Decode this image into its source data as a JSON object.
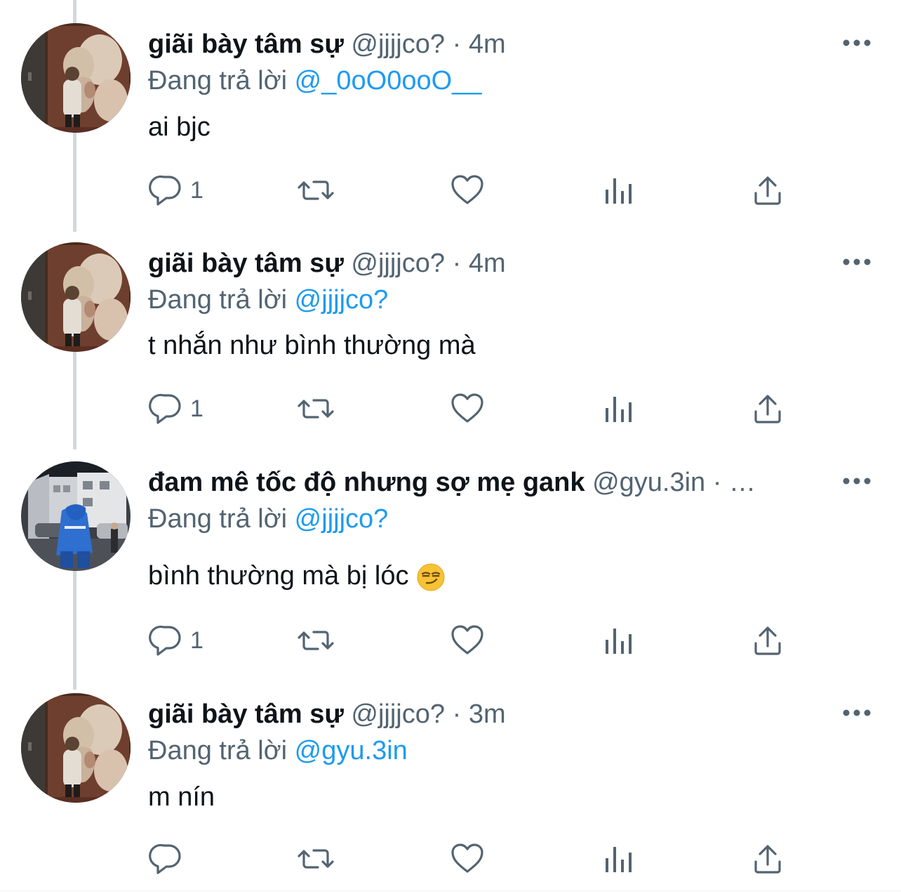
{
  "colors": {
    "text": "#0f1419",
    "secondary": "#536471",
    "link": "#1d9bf0",
    "thread_line": "#cfd9de"
  },
  "tweets": [
    {
      "name": "giãi bày tâm sự",
      "handle": "@jjjjco?",
      "separator": "·",
      "time": "4m",
      "reply_prefix": "Đang trả lời",
      "reply_to": "@_0oO0ooO__",
      "text": "ai bjc",
      "reply_count": "1",
      "avatar_icon": "painting-avatar"
    },
    {
      "name": "giãi bày tâm sự",
      "handle": "@jjjjco?",
      "separator": "·",
      "time": "4m",
      "reply_prefix": "Đang trả lời",
      "reply_to": "@jjjjco?",
      "text": "t nhắn như bình thường mà",
      "reply_count": "1",
      "avatar_icon": "painting-avatar"
    },
    {
      "name": "đam mê tốc độ nhưng sợ mẹ gank",
      "handle": "@gyu.3in",
      "separator": "·",
      "time": "…",
      "reply_prefix": "Đang trả lời",
      "reply_to": "@jjjjco?",
      "text": "bình thường mà bị lóc",
      "reply_count": "1",
      "avatar_icon": "street-hoodie-avatar",
      "emoji_icon": "smirking-face-emoji"
    },
    {
      "name": "giãi bày tâm sự",
      "handle": "@jjjjco?",
      "separator": "·",
      "time": "3m",
      "reply_prefix": "Đang trả lời",
      "reply_to": "@gyu.3in",
      "text": "m nín",
      "reply_count": "",
      "avatar_icon": "painting-avatar"
    }
  ]
}
